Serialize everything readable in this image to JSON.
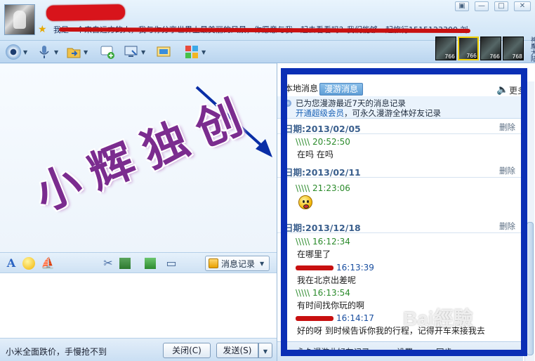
{
  "header": {
    "signature": "我是一个来自远方的人，我与你分享世界上最美丽的风景，你愿意与我一起去看看吗？我们能够一起旅行1515123300 刘",
    "window_buttons": {
      "menu": "▣",
      "minimize": "—",
      "maximize": "□",
      "close": "✕"
    }
  },
  "toolbar": {
    "items": [
      "camera-icon",
      "microphone-icon",
      "folder-transfer-icon",
      "chat-add-icon",
      "remote-desktop-icon",
      "share-screen-icon",
      "apps-icon"
    ]
  },
  "game_bar": {
    "levels": [
      "766",
      "766",
      "766",
      "768"
    ],
    "label": "神魔大陆"
  },
  "watermark": "小辉独创",
  "format_bar": {
    "font_icon": "A",
    "message_record_label": "消息记录"
  },
  "bottom": {
    "ad_text": "小米全面跌价，手慢抢不到",
    "close_label": "关闭(C)",
    "send_label": "发送(S)"
  },
  "history": {
    "tabs": [
      "本地消息",
      "漫游消息"
    ],
    "more": "更多",
    "notice_line1": "已为您漫游最近7天的消息记录",
    "notice_link": "开通超级会员",
    "notice_rest": "，可永久漫游全体好友记录",
    "delete_label": "删除",
    "days": [
      {
        "date": "日期:2013/02/05",
        "messages": [
          {
            "sender": "\\\\\\\\\\",
            "time": "20:52:50",
            "text": "在吗 在吗",
            "peer": false
          }
        ]
      },
      {
        "date": "日期:2013/02/11",
        "messages": [
          {
            "sender": "\\\\\\\\\\",
            "time": "21:23:06",
            "text": "",
            "peer": false,
            "emoji": true
          }
        ]
      },
      {
        "date": "日期:2013/12/18",
        "messages": [
          {
            "sender": "\\\\\\\\\\",
            "time": "16:12:34",
            "text": "在哪里了",
            "peer": false
          },
          {
            "sender": "",
            "time": "16:13:39",
            "text": "我在北京出差呢",
            "peer": true
          },
          {
            "sender": "\\\\\\\\\\",
            "time": "16:13:54",
            "text": "有时间找你玩的啊",
            "peer": false
          },
          {
            "sender": "",
            "time": "16:14:17",
            "text": "好的呀 到时候告诉你我的行程，记得开车来接我去",
            "peer": true
          }
        ]
      }
    ],
    "footer": {
      "roam": "永久漫游此好友记录",
      "settings": "设置",
      "filter": "同步"
    }
  },
  "baidu_watermark": "Bai經驗"
}
